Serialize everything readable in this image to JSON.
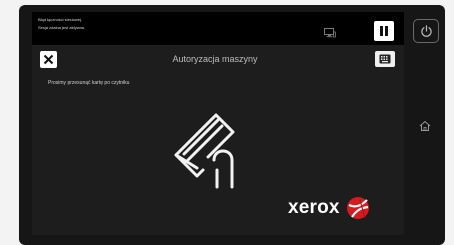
{
  "status": {
    "line1": "Błąd łączności sieciowej.",
    "line2": "Sesja zdalna jest aktywna."
  },
  "header": {
    "title": "Autoryzacja maszyny"
  },
  "main": {
    "instruction": "Prosimy przesunąć kartę po czytniku"
  },
  "brand": {
    "name": "xerox"
  },
  "icons": {
    "monitor": "monitor-icon",
    "pause": "pause-icon",
    "power": "power-icon",
    "home": "home-icon",
    "close": "close-icon",
    "keyboard": "keyboard-icon",
    "card_swipe": "card-swipe-icon"
  },
  "colors": {
    "screen_background": "#1d1d1d",
    "status_bar": "#000000",
    "brand_red": "#d71920"
  }
}
